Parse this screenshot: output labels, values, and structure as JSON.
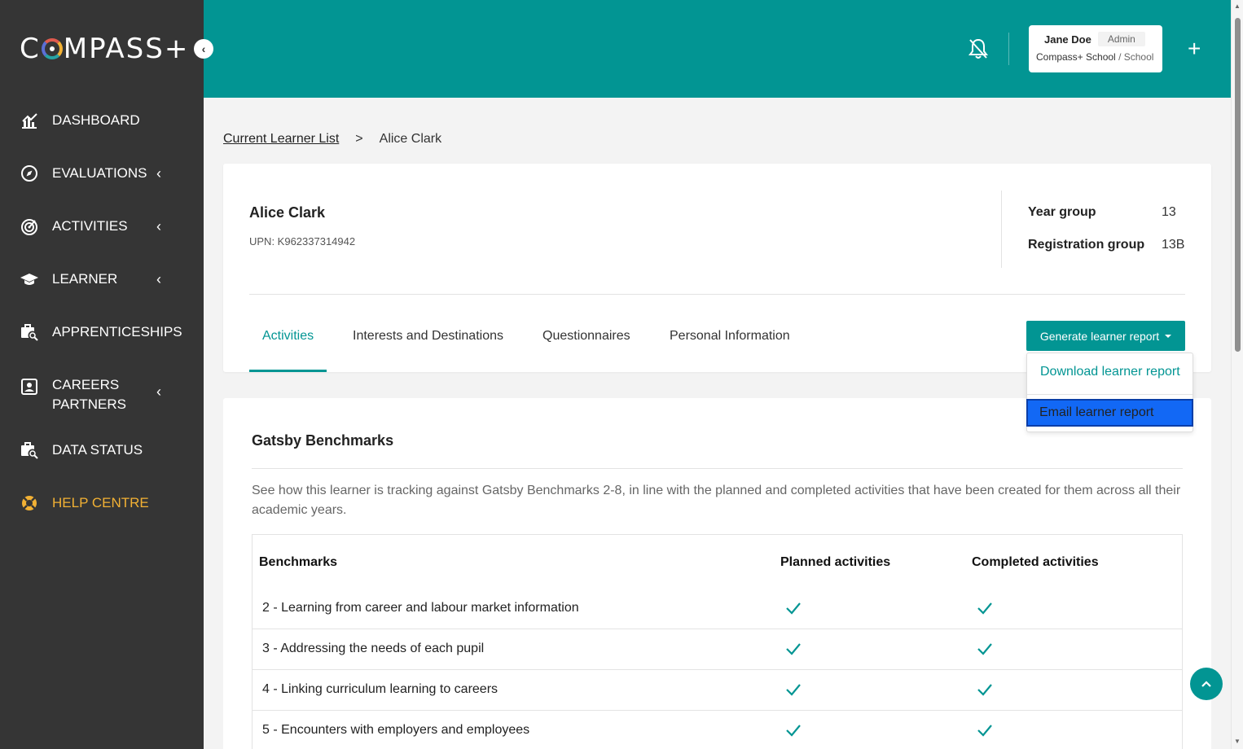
{
  "sidebar": {
    "logo": {
      "pre": "C",
      "post": "MPASS+"
    },
    "items": [
      {
        "label": "DASHBOARD",
        "icon": "dashboard-chart-icon"
      },
      {
        "label": "EVALUATIONS",
        "icon": "compass-icon"
      },
      {
        "label": "ACTIVITIES",
        "icon": "target-icon"
      },
      {
        "label": "LEARNER",
        "icon": "graduation-cap-icon"
      },
      {
        "label": "APPRENTICESHIPS",
        "icon": "briefcase-search-icon"
      },
      {
        "label1": "CAREERS",
        "label2": "PARTNERS",
        "icon": "contact-card-icon"
      },
      {
        "label": "DATA STATUS",
        "icon": "briefcase-search-icon"
      },
      {
        "label": "HELP CENTRE",
        "icon": "lifebuoy-icon"
      }
    ]
  },
  "header": {
    "user": {
      "name": "Jane Doe",
      "role": "Admin",
      "school": "Compass+ School",
      "org_type": "/ School"
    },
    "colors": {
      "brand": "#029593",
      "sidebar": "#353535",
      "help": "#f2b134"
    }
  },
  "breadcrumb": {
    "parent": "Current Learner List",
    "separator": ">",
    "current": "Alice Clark"
  },
  "learner": {
    "name": "Alice Clark",
    "upn": "UPN: K962337314942",
    "year_group_label": "Year group",
    "year_group": "13",
    "registration_group_label": "Registration group",
    "registration_group": "13B"
  },
  "tabs": [
    {
      "label": "Activities",
      "active": true
    },
    {
      "label": "Interests and Destinations"
    },
    {
      "label": "Questionnaires"
    },
    {
      "label": "Personal Information"
    }
  ],
  "report": {
    "button_label": "Generate learner report",
    "options": [
      "Download learner report",
      "Email learner report"
    ],
    "highlighted": "Email learner report"
  },
  "gatsby": {
    "title": "Gatsby Benchmarks",
    "description": "See how this learner is tracking against Gatsby Benchmarks 2-8, in line with the planned and completed activities that have been created for them across all their academic years.",
    "columns": [
      "Benchmarks",
      "Planned activities",
      "Completed activities"
    ],
    "rows": [
      {
        "name": "2 - Learning from career and labour market information",
        "planned": true,
        "completed": true
      },
      {
        "name": "3 - Addressing the needs of each pupil",
        "planned": true,
        "completed": true
      },
      {
        "name": "4 - Linking curriculum learning to careers",
        "planned": true,
        "completed": true
      },
      {
        "name": "5 - Encounters with employers and employees",
        "planned": true,
        "completed": true
      }
    ]
  }
}
